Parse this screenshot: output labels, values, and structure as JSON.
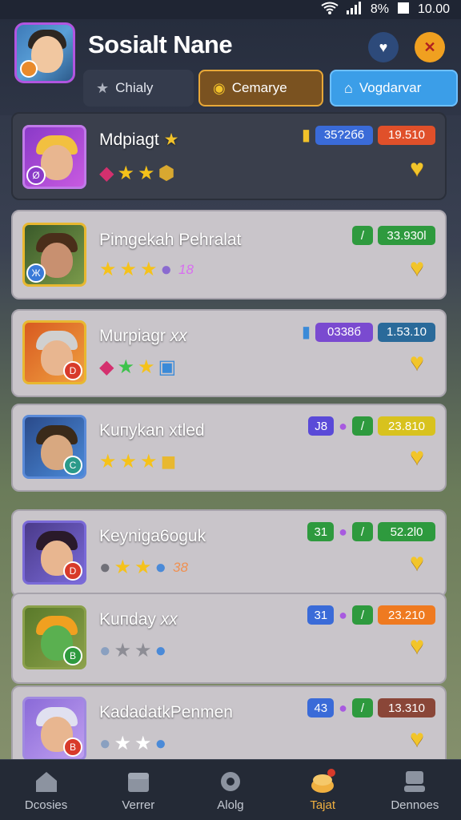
{
  "status_bar": {
    "battery": "8%",
    "time": "10.00"
  },
  "header": {
    "title": "Sosialt Nane",
    "tabs": [
      {
        "label": "Chialy",
        "icon": "star-icon"
      },
      {
        "label": "Cemaryе",
        "icon": "coin-icon"
      },
      {
        "label": "Vogdarvar",
        "icon": "home-icon"
      }
    ]
  },
  "players": [
    {
      "name": "Mdpiagt",
      "tag": "★",
      "stat1": "35?2б6",
      "stat2": "19.510",
      "stat1_color": "#3a6bd8",
      "stat2_color": "#e0502a",
      "icons": [
        "gem",
        "star",
        "star",
        "coin"
      ]
    },
    {
      "name": "Pimgekah Pehralat",
      "tag": "",
      "stat_small": "/",
      "stat2": "33.930l",
      "stat2_color": "#2e9a3e",
      "icons": [
        "star",
        "star",
        "star",
        "orb"
      ],
      "extra": "18"
    },
    {
      "name": "Murpiagr",
      "tag": "xx",
      "stat1": "0338б",
      "stat2": "1.53.10",
      "stat1_color": "#7a4ad0",
      "stat2_color": "#2a6a9a",
      "icons": [
        "gem",
        "gem-green",
        "star",
        "cube"
      ]
    },
    {
      "name": "Kuпykan xtled",
      "tag": "",
      "stat_small": "J8",
      "stat2": "23.810",
      "stat2_color": "#d8c21e",
      "icons": [
        "star",
        "star",
        "star",
        "cube-gold"
      ]
    },
    {
      "name": "Keyniga6oguk",
      "tag": "",
      "stat_small": "31",
      "stat2": "52.2l0",
      "stat2_color": "#2e9a3e",
      "icons": [
        "orb-gray",
        "star",
        "star",
        "orb"
      ],
      "extra": "38"
    },
    {
      "name": "Kuпday",
      "tag": "xx",
      "stat_small": "31",
      "stat2": "23.210",
      "stat2_color": "#ef7a20",
      "icons": [
        "orb-gray",
        "star-empty",
        "star-empty",
        "orb"
      ]
    },
    {
      "name": "KadadatkPenmen",
      "tag": "",
      "stat_small": "43",
      "stat2": "13.310",
      "stat2_color": "#8a4638",
      "icons": [
        "orb-gray",
        "star-white",
        "star-white",
        "orb"
      ]
    }
  ],
  "nav": [
    {
      "label": "Dcosies"
    },
    {
      "label": "Verrer"
    },
    {
      "label": "Alolg"
    },
    {
      "label": "Tajat"
    },
    {
      "label": "Dennoes"
    }
  ]
}
